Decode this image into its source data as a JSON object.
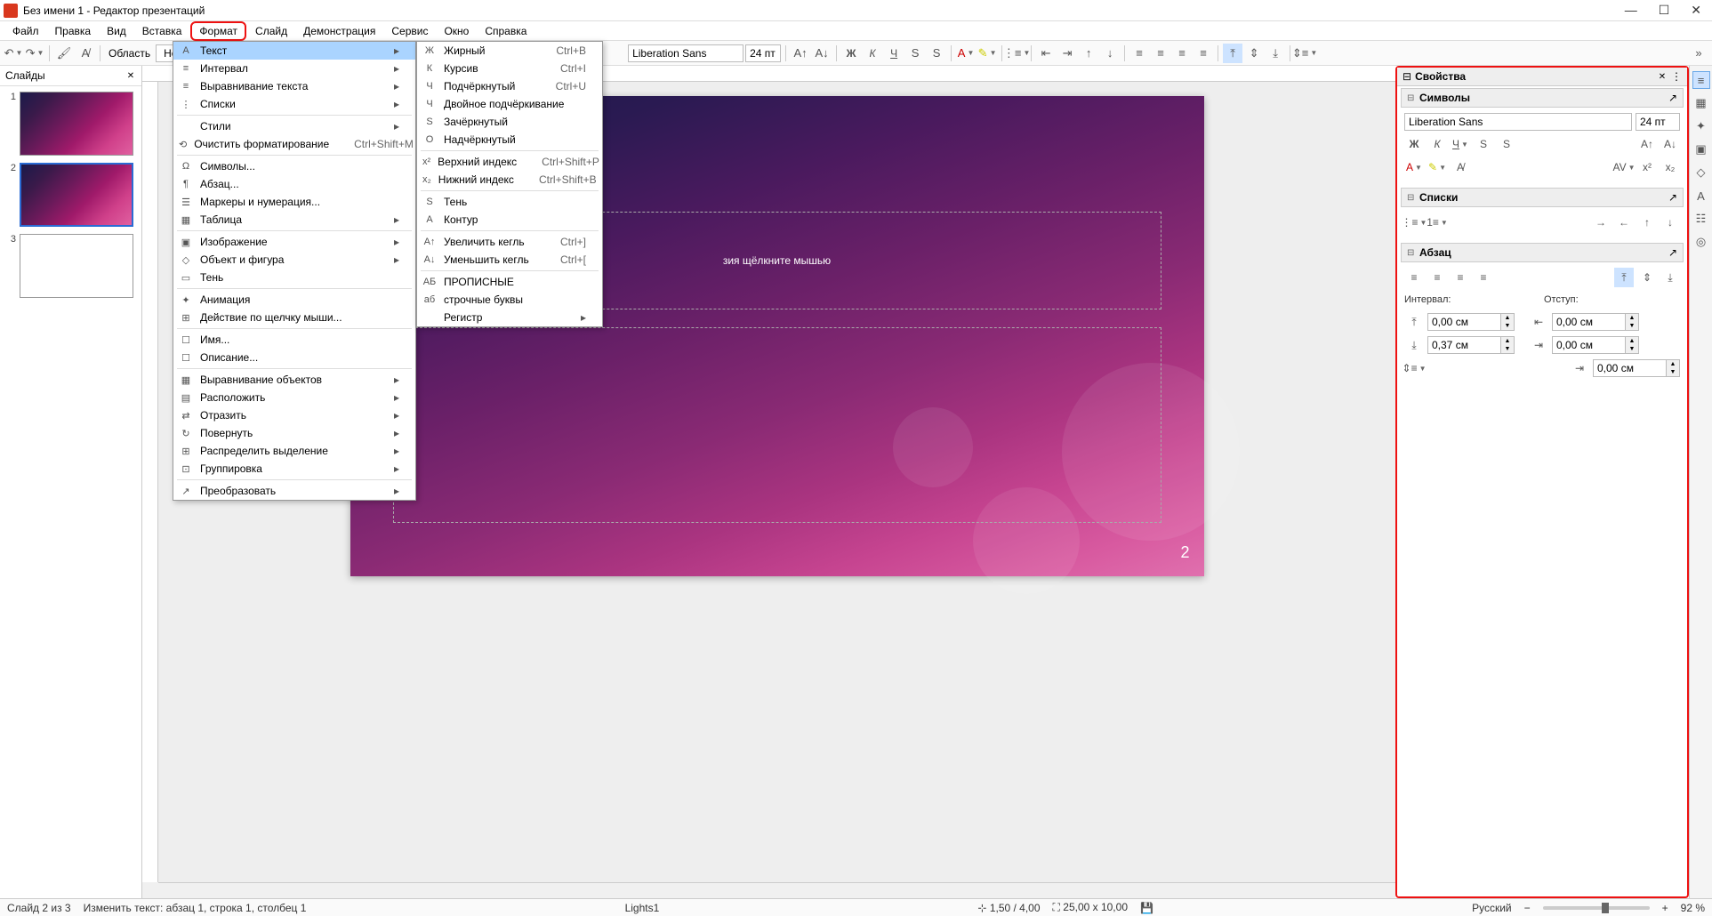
{
  "window": {
    "title": "Без имени 1 - Редактор презентаций"
  },
  "menubar": [
    "Файл",
    "Правка",
    "Вид",
    "Вставка",
    "Формат",
    "Слайд",
    "Демонстрация",
    "Сервис",
    "Окно",
    "Справка"
  ],
  "menubar_hl_index": 4,
  "toolbar": {
    "area_label": "Область",
    "none_label": "Нет",
    "font_name": "Liberation Sans",
    "font_size": "24 пт"
  },
  "format_menu": [
    {
      "icon": "A",
      "label": "Текст",
      "arrow": true,
      "hl": true
    },
    {
      "icon": "≡",
      "label": "Интервал",
      "arrow": true
    },
    {
      "icon": "≡",
      "label": "Выравнивание текста",
      "arrow": true
    },
    {
      "icon": "⋮",
      "label": "Списки",
      "arrow": true
    },
    {
      "sep": true
    },
    {
      "icon": "",
      "label": "Стили",
      "arrow": true
    },
    {
      "icon": "⟲",
      "label": "Очистить форматирование",
      "shortcut": "Ctrl+Shift+M"
    },
    {
      "sep": true
    },
    {
      "icon": "Ω",
      "label": "Символы..."
    },
    {
      "icon": "¶",
      "label": "Абзац..."
    },
    {
      "icon": "☰",
      "label": "Маркеры и нумерация..."
    },
    {
      "icon": "▦",
      "label": "Таблица",
      "arrow": true
    },
    {
      "sep": true
    },
    {
      "icon": "▣",
      "label": "Изображение",
      "arrow": true
    },
    {
      "icon": "◇",
      "label": "Объект и фигура",
      "arrow": true
    },
    {
      "icon": "▭",
      "label": "Тень"
    },
    {
      "sep": true
    },
    {
      "icon": "✦",
      "label": "Анимация"
    },
    {
      "icon": "⊞",
      "label": "Действие по щелчку мыши..."
    },
    {
      "sep": true
    },
    {
      "icon": "☐",
      "label": "Имя..."
    },
    {
      "icon": "☐",
      "label": "Описание..."
    },
    {
      "sep": true
    },
    {
      "icon": "▦",
      "label": "Выравнивание объектов",
      "arrow": true
    },
    {
      "icon": "▤",
      "label": "Расположить",
      "arrow": true
    },
    {
      "icon": "⇄",
      "label": "Отразить",
      "arrow": true
    },
    {
      "icon": "↻",
      "label": "Повернуть",
      "arrow": true
    },
    {
      "icon": "⊞",
      "label": "Распределить выделение",
      "arrow": true
    },
    {
      "icon": "⊡",
      "label": "Группировка",
      "arrow": true
    },
    {
      "sep": true
    },
    {
      "icon": "↗",
      "label": "Преобразовать",
      "arrow": true
    }
  ],
  "text_submenu": [
    {
      "icon": "Ж",
      "label": "Жирный",
      "shortcut": "Ctrl+B"
    },
    {
      "icon": "К",
      "label": "Курсив",
      "shortcut": "Ctrl+I"
    },
    {
      "icon": "Ч",
      "label": "Подчёркнутый",
      "shortcut": "Ctrl+U"
    },
    {
      "icon": "Ч",
      "label": "Двойное подчёркивание"
    },
    {
      "icon": "S",
      "label": "Зачёркнутый"
    },
    {
      "icon": "O",
      "label": "Надчёркнутый"
    },
    {
      "sep": true
    },
    {
      "icon": "x²",
      "label": "Верхний индекс",
      "shortcut": "Ctrl+Shift+P"
    },
    {
      "icon": "x₂",
      "label": "Нижний индекс",
      "shortcut": "Ctrl+Shift+B"
    },
    {
      "sep": true
    },
    {
      "icon": "S",
      "label": "Тень"
    },
    {
      "icon": "A",
      "label": "Контур"
    },
    {
      "sep": true
    },
    {
      "icon": "A↑",
      "label": "Увеличить кегль",
      "shortcut": "Ctrl+]"
    },
    {
      "icon": "A↓",
      "label": "Уменьшить кегль",
      "shortcut": "Ctrl+["
    },
    {
      "sep": true
    },
    {
      "icon": "АБ",
      "label": "ПРОПИСНЫЕ"
    },
    {
      "icon": "аб",
      "label": "строчные буквы"
    },
    {
      "icon": "",
      "label": "Регистр",
      "arrow": true
    }
  ],
  "slides_panel": {
    "title": "Слайды",
    "slides": [
      {
        "num": "1",
        "gradient": true
      },
      {
        "num": "2",
        "gradient": true,
        "selected": true
      },
      {
        "num": "3",
        "gradient": false
      }
    ]
  },
  "slide_content": {
    "title_placeholder_visible": "зия щёлкните мышью",
    "page_number": "2"
  },
  "properties": {
    "title": "Свойства",
    "sections": {
      "symbols": {
        "title": "Символы",
        "font_name": "Liberation Sans",
        "font_size": "24 пт"
      },
      "lists": {
        "title": "Списки"
      },
      "paragraph": {
        "title": "Абзац",
        "interval_label": "Интервал:",
        "indent_label": "Отступ:",
        "spacing_above": "0,00 см",
        "spacing_below": "0,37 см",
        "indent_before": "0,00 см",
        "indent_after": "0,00 см",
        "indent_first": "0,00 см"
      }
    }
  },
  "statusbar": {
    "slide_info": "Слайд 2 из 3",
    "edit_info": "Изменить текст: абзац 1, строка 1, столбец 1",
    "template": "Lights1",
    "pos": "1,50 / 4,00",
    "size": "25,00 x 10,00",
    "lang": "Русский",
    "zoom": "92 %"
  }
}
